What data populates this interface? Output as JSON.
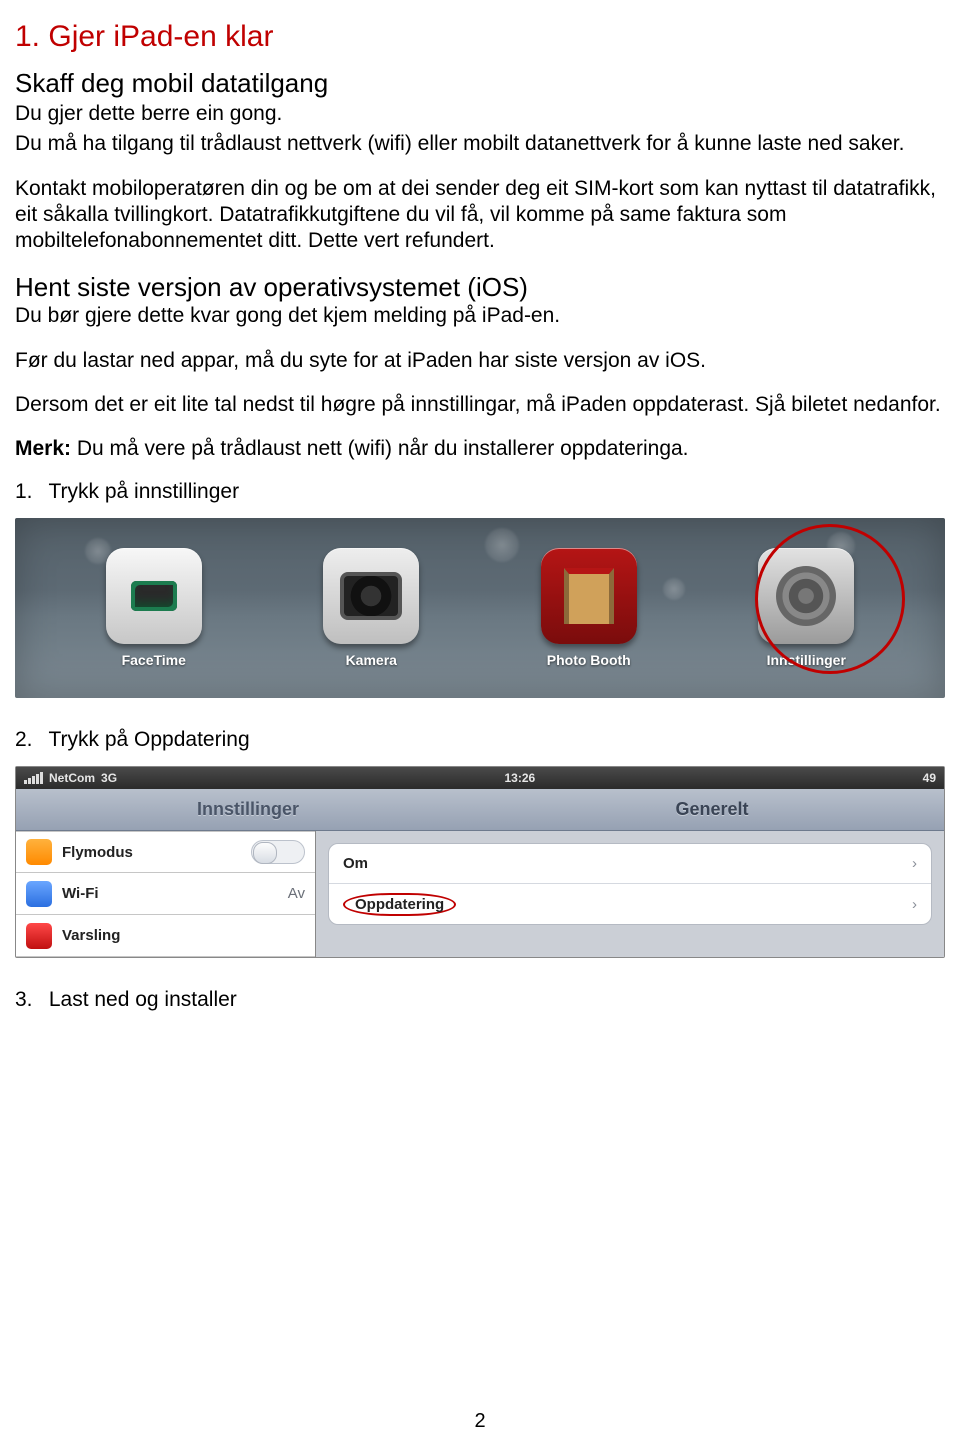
{
  "heading": "1. Gjer iPad-en klar",
  "sub_heading_1": "Skaff deg mobil datatilgang",
  "p1": "Du gjer dette berre ein gong.",
  "p2": "Du må ha tilgang til trådlaust nettverk (wifi) eller mobilt datanettverk for å kunne laste ned saker.",
  "p3": "Kontakt mobiloperatøren din og be om at dei sender deg eit SIM-kort som kan nyttast til datatrafikk, eit såkalla tvillingkort. Datatrafikkutgiftene du vil få, vil komme på same faktura som mobiltelefonabonnementet ditt. Dette vert refundert.",
  "sub_heading_2": "Hent siste versjon av operativsystemet (iOS)",
  "p4": "Du bør gjere dette kvar gong det kjem melding på iPad-en.",
  "p5": "Før du lastar ned appar, må du syte for at iPaden har siste versjon av iOS.",
  "p6": "Dersom det er eit lite tal nedst til høgre på innstillingar, må iPaden oppdaterast. Sjå biletet nedanfor.",
  "merk_label": "Merk:",
  "p7": " Du må vere på trådlaust nett (wifi) når du installerer oppdateringa.",
  "steps": {
    "s1_num": "1.",
    "s1_text": "Trykk på innstillinger",
    "s2_num": "2.",
    "s2_text": "Trykk på Oppdatering",
    "s3_num": "3.",
    "s3_text": "Last ned og installer"
  },
  "shot1": {
    "facetime": "FaceTime",
    "kamera": "Kamera",
    "photobooth": "Photo Booth",
    "innstillinger": "Innstillinger"
  },
  "shot2": {
    "carrier": "NetCom",
    "network": "3G",
    "time": "13:26",
    "battery": "49",
    "left_title": "Innstillinger",
    "right_title": "Generelt",
    "flymodus": "Flymodus",
    "wifi": "Wi-Fi",
    "wifi_value": "Av",
    "varsling": "Varsling",
    "om": "Om",
    "oppdatering": "Oppdatering"
  },
  "page_number": "2"
}
